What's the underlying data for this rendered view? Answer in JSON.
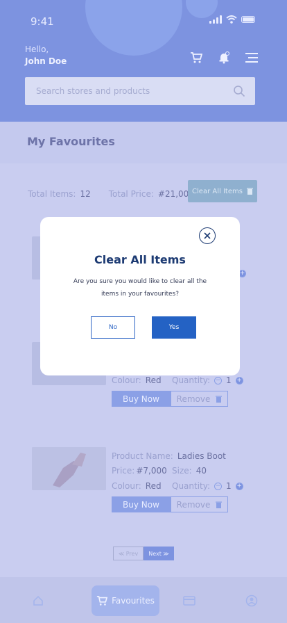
{
  "status": {
    "time": "9:41"
  },
  "header": {
    "greeting": "Hello,",
    "user_name": "John Doe"
  },
  "search": {
    "placeholder": "Search stores and products"
  },
  "page": {
    "title": "My Favourites"
  },
  "summary": {
    "total_items_label": "Total Items:",
    "total_items_value": "12",
    "total_price_label": "Total Price:",
    "total_price_value": "#21,000",
    "clear_all_label": "Clear All Items"
  },
  "products": [
    {
      "colour_label": "Colour:",
      "colour": "Red",
      "quantity_label": "Quantity:",
      "quantity": "1",
      "buy_label": "Buy Now",
      "remove_label": "Remove"
    },
    {
      "name_label": "Product Name:",
      "name": "Ladies Boot",
      "price_label": "Price:",
      "price": "#7,000",
      "size_label": "Size:",
      "size": "40",
      "colour_label": "Colour:",
      "colour": "Red",
      "quantity_label": "Quantity:",
      "quantity": "1",
      "buy_label": "Buy Now",
      "remove_label": "Remove"
    }
  ],
  "pager": {
    "prev": "≪ Prev",
    "next": "Next ≫"
  },
  "tabbar": {
    "active_label": "Favourites"
  },
  "modal": {
    "title": "Clear All Items",
    "message": "Are you sure you would like to clear all the items in your favourites?",
    "no_label": "No",
    "yes_label": "Yes"
  }
}
